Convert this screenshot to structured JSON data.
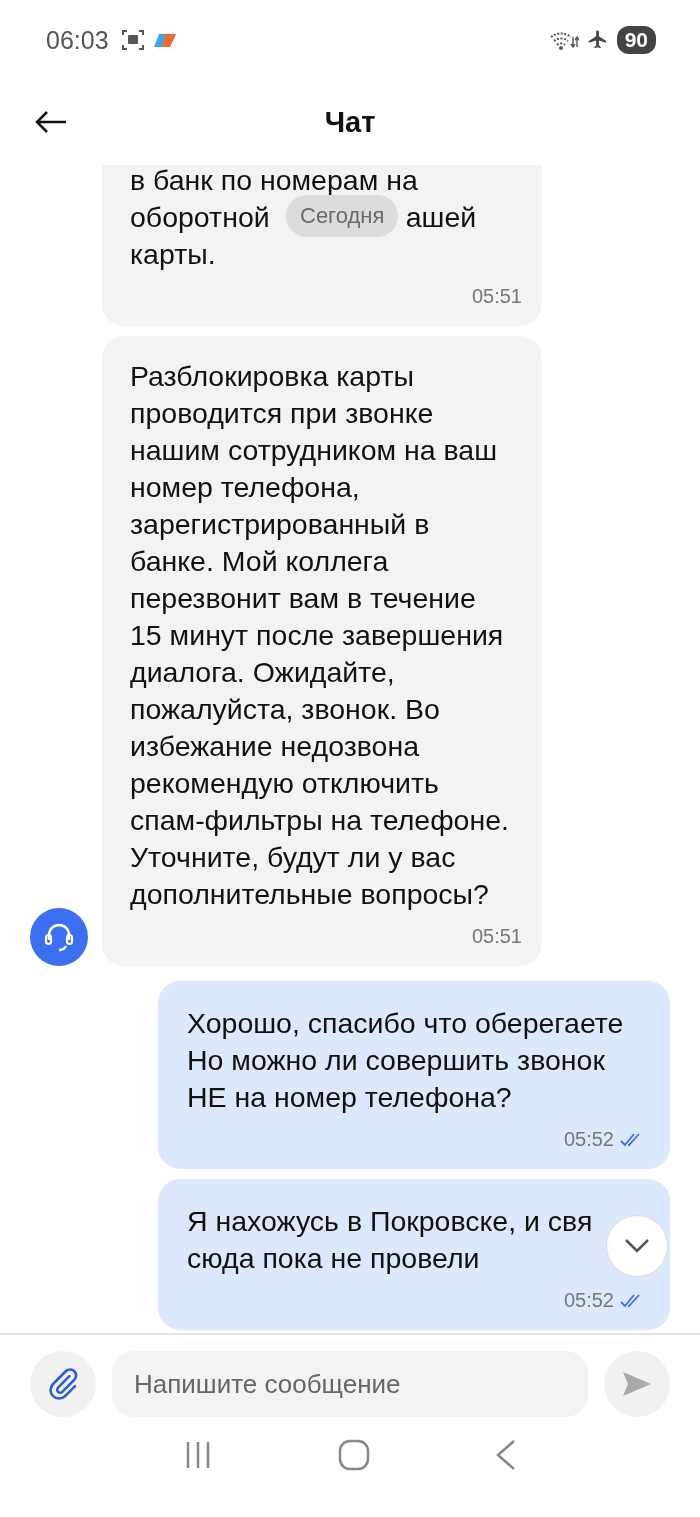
{
  "status_bar": {
    "time": "06:03",
    "battery": "90"
  },
  "header": {
    "title": "Чат"
  },
  "date_chip": "Сегодня",
  "messages": [
    {
      "kind": "incoming",
      "show_avatar": false,
      "lines": [
        [
          "в банк по номерам на"
        ],
        [
          "оборотной",
          "ашей"
        ],
        [
          "карты."
        ]
      ],
      "time": "05:51"
    },
    {
      "kind": "incoming",
      "show_avatar": true,
      "lines": [
        [
          "Разблокировка карты"
        ],
        [
          "проводится при звонке"
        ],
        [
          "нашим сотрудником на ваш"
        ],
        [
          "номер телефона,"
        ],
        [
          "зарегистрированный в"
        ],
        [
          "банке. Мой коллега"
        ],
        [
          "перезвонит вам в течение"
        ],
        [
          "15 минут после завершения"
        ],
        [
          "диалога. Ожидайте,"
        ],
        [
          "пожалуйста, звонок. Во"
        ],
        [
          "избежание недозвона"
        ],
        [
          "рекомендую отключить"
        ],
        [
          "спам-фильтры на телефоне."
        ],
        [
          "Уточните, будут ли у вас"
        ],
        [
          "дополнительные вопросы?"
        ]
      ],
      "time": "05:51"
    },
    {
      "kind": "outgoing",
      "read": true,
      "lines": [
        [
          "Хорошо, спасибо что оберегаете"
        ],
        [
          "Но можно ли совершить звонок"
        ],
        [
          "НЕ на номер телефона?"
        ]
      ],
      "time": "05:52"
    },
    {
      "kind": "outgoing",
      "read": true,
      "lines": [
        [
          "Я нахожусь в Покровске, и свя"
        ],
        [
          "сюда пока не провели"
        ]
      ],
      "time": "05:52"
    }
  ],
  "composer": {
    "placeholder": "Напишите сообщение"
  }
}
